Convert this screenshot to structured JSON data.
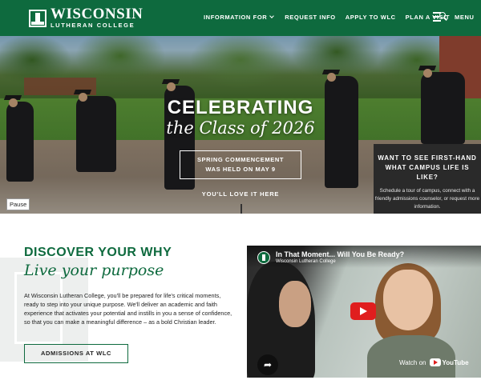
{
  "header": {
    "logo_line1": "WISCONSIN",
    "logo_line2": "LUTHERAN COLLEGE",
    "nav": {
      "info_for": "INFORMATION FOR",
      "request_info": "REQUEST INFO",
      "apply": "APPLY TO WLC",
      "visit": "PLAN A VISIT"
    },
    "menu_label": "MENU",
    "icons": {
      "logo": "college-tower-icon",
      "menu": "menu-search-icon",
      "dropdown": "chevron-down-icon"
    }
  },
  "hero": {
    "title": "CELEBRATING",
    "subtitle": "the Class of 2026",
    "box_line1": "SPRING COMMENCEMENT",
    "box_line2": "WAS HELD ON MAY 9",
    "love": "YOU'LL LOVE IT HERE",
    "pause": "Pause"
  },
  "panel": {
    "heading": "WANT TO SEE FIRST-HAND WHAT CAMPUS LIFE IS LIKE?",
    "body": "Schedule a tour of campus, connect with a friendly admissions counselor, or request more information."
  },
  "intro": {
    "discover": "DISCOVER YOUR",
    "why": "WHY",
    "tagline": "Live your purpose",
    "body": "At Wisconsin Lutheran College, you'll be prepared for life's critical moments, ready to step into your unique purpose. We'll deliver an academic and faith experience that activates your potential and instills in you a sense of confidence, so that you can make a meaningful difference – as a bold Christian leader.",
    "button": "ADMISSIONS AT WLC"
  },
  "video": {
    "title": "In That Moment... Will You Be Ready?",
    "channel": "Wisconsin Lutheran College",
    "watch_on": "Watch on",
    "platform": "YouTube",
    "icons": {
      "play": "play-icon",
      "share": "share-icon",
      "channel": "channel-logo-icon"
    }
  },
  "colors": {
    "brand_green": "#0e6a3e",
    "panel_dark": "#2a2a2a",
    "play_red": "#e01e1e"
  }
}
